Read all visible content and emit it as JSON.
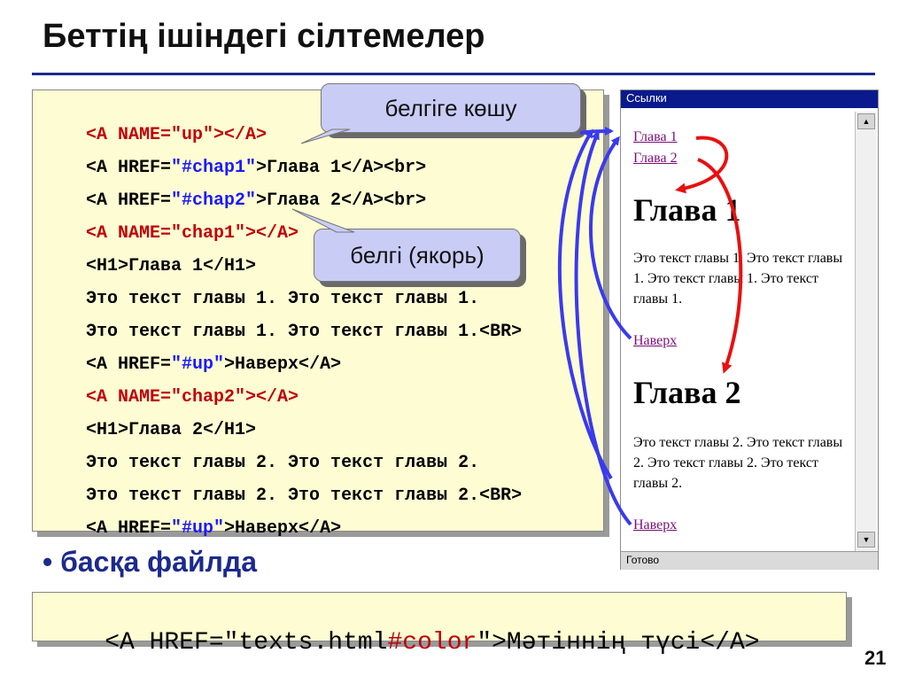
{
  "slide": {
    "title": "Беттің ішіндегі сілтемелер",
    "page_number": "21",
    "bullet": "• басқа файлда"
  },
  "code_lines": [
    {
      "pre": "",
      "red": "<A NAME=\"up\"></A>",
      "blue": "",
      "post": ""
    },
    {
      "pre": "<A HREF=",
      "red": "",
      "blue": "\"#chap1\"",
      "post": ">Глава 1</A><br>"
    },
    {
      "pre": "<A HREF=",
      "red": "",
      "blue": "\"#chap2\"",
      "post": ">Глава 2</A><br>"
    },
    {
      "pre": "",
      "red": "<A NAME=\"chap1\"></A>",
      "blue": "",
      "post": ""
    },
    {
      "pre": "<H1>Глава 1</H1>",
      "red": "",
      "blue": "",
      "post": ""
    },
    {
      "pre": "Это текст главы 1. Это текст главы 1.",
      "red": "",
      "blue": "",
      "post": ""
    },
    {
      "pre": "Это текст главы 1. Это текст главы 1.<BR>",
      "red": "",
      "blue": "",
      "post": ""
    },
    {
      "pre": "<A HREF=",
      "red": "",
      "blue": "\"#up\"",
      "post": ">Наверх</A>"
    },
    {
      "pre": "",
      "red": "<A NAME=\"chap2\"></A>",
      "blue": "",
      "post": ""
    },
    {
      "pre": "<H1>Глава 2</H1>",
      "red": "",
      "blue": "",
      "post": ""
    },
    {
      "pre": "Это текст главы 2. Это текст главы 2.",
      "red": "",
      "blue": "",
      "post": ""
    },
    {
      "pre": "Это текст главы 2. Это текст главы 2.<BR>",
      "red": "",
      "blue": "",
      "post": ""
    },
    {
      "pre": "<A HREF=",
      "red": "",
      "blue": "\"#up\"",
      "post": ">Наверх</A>"
    }
  ],
  "callouts": {
    "jump_to_anchor": "белгіге көшу",
    "anchor": "белгі (якорь)"
  },
  "browser": {
    "title": "Ссылки",
    "status": "Готово",
    "links": {
      "chap1": "Глава 1",
      "chap2": "Глава 2",
      "up1": "Наверх",
      "up2": "Наверх"
    },
    "headings": {
      "h1": "Глава 1",
      "h2": "Глава 2"
    },
    "paragraphs": {
      "p1": "Это текст главы 1. Это текст главы 1. Это текст главы 1. Это текст главы 1.",
      "p2": "Это текст главы 2. Это текст главы 2. Это текст главы 2. Это текст главы 2."
    },
    "scroll_up_glyph": "▲",
    "scroll_down_glyph": "▼"
  },
  "code2": {
    "pre": "<A HREF=\"texts.html",
    "red": "#color",
    "post": "\">Мәтіннің түсі</A>"
  },
  "colors": {
    "title_rule": "#1c2a8c",
    "code_bg": "#fdfcd2",
    "callout_bg": "#c9cdf5",
    "anchor_red": "#c0000a",
    "href_blue": "#1a1aff",
    "arrow_blue": "#3a3aee",
    "arrow_red": "#e81010",
    "visited_link": "#7a0e77"
  }
}
